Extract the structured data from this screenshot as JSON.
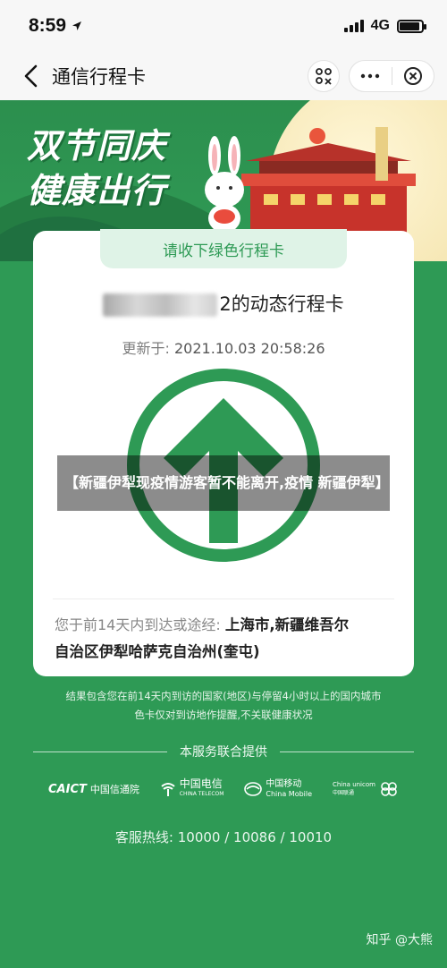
{
  "status": {
    "time": "8:59",
    "network": "4G",
    "battery_level": 0.9
  },
  "nav": {
    "title": "通信行程卡"
  },
  "banner": {
    "line1": "双节同庆",
    "line2": "健康出行"
  },
  "card": {
    "tab": "请收下绿色行程卡",
    "heading_masked_digit": "2",
    "heading_suffix": "的动态行程卡",
    "update_label": "更新于:",
    "update_time": "2021.10.03 20:58:26",
    "code_color": "#2e9a55",
    "route_label": "您于前14天内到达或途经:",
    "route_line1": "上海市,新疆维吾尔",
    "route_line2": "自治区伊犁哈萨克自治州(奎屯)"
  },
  "overlay": {
    "caption": "【新疆伊犁现疫情游客暂不能离开,疫情 新疆伊犁】"
  },
  "footer": {
    "note_line1": "结果包含您在前14天内到访的国家(地区)与停留4小时以上的国内城市",
    "note_line2": "色卡仅对到访地作提醒,不关联健康状况",
    "provided_by": "本服务联合提供",
    "logos": {
      "caict_en": "CAICT",
      "caict_cn": "中国信通院",
      "telecom_cn": "中国电信",
      "telecom_en": "CHINA TELECOM",
      "mobile_cn": "中国移动",
      "mobile_en": "China Mobile",
      "unicom_cn": "中国联通",
      "unicom_en": "China unicom"
    },
    "hotline": "客服热线: 10000 / 10086 / 10010",
    "watermark": "知乎 @大熊"
  }
}
